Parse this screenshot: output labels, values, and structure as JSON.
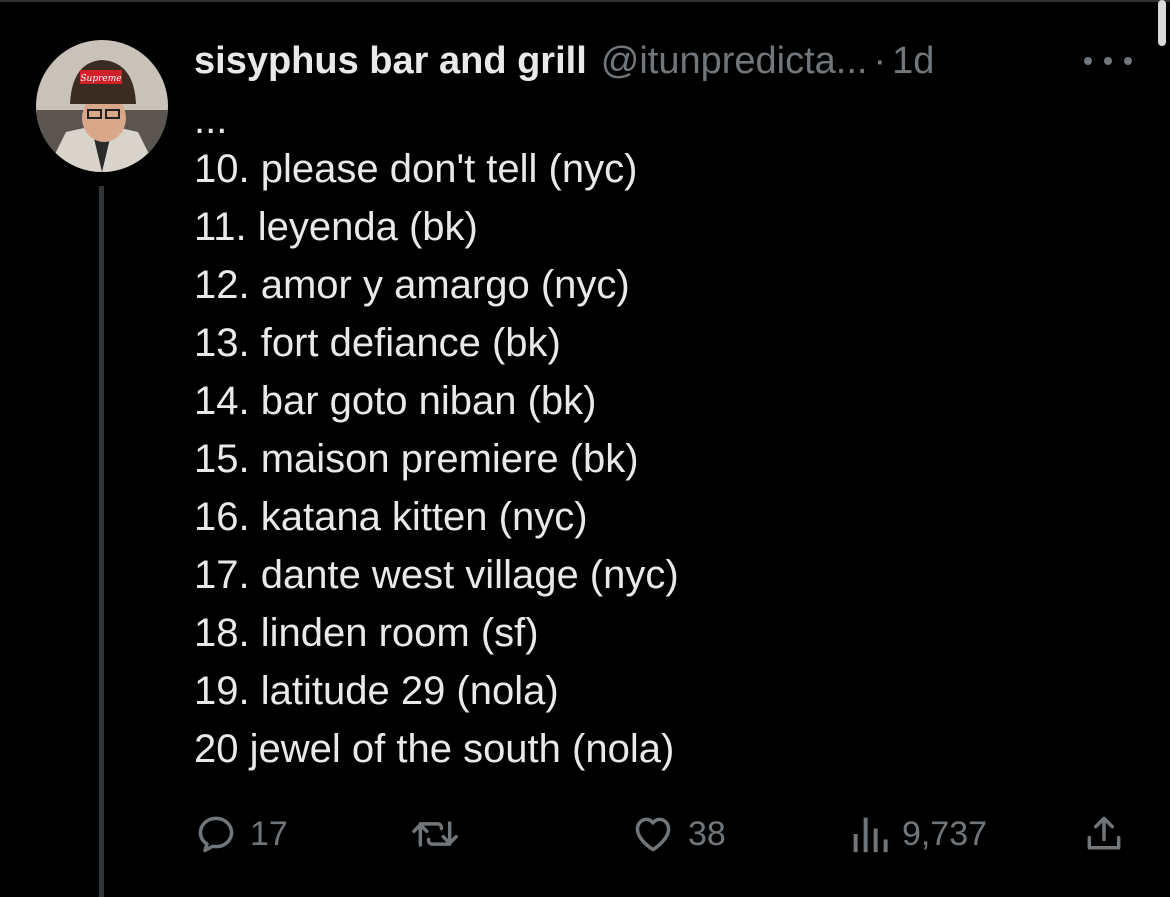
{
  "tweet": {
    "display_name": "sisyphus bar and grill",
    "handle": "@itunpredicta...",
    "separator": "·",
    "time": "1d",
    "lines": [
      "...",
      "10. please don't tell (nyc)",
      "11. leyenda (bk)",
      "12. amor y amargo (nyc)",
      "13. fort defiance (bk)",
      "14. bar goto niban (bk)",
      "15. maison premiere (bk)",
      "16. katana kitten (nyc)",
      "17. dante west village (nyc)",
      "18. linden room (sf)",
      "19. latitude 29 (nola)",
      "20 jewel of the south (nola)"
    ]
  },
  "actions": {
    "reply_count": "17",
    "retweet_count": "",
    "like_count": "38",
    "view_count": "9,737"
  },
  "icons": {
    "avatar": "avatar-photo",
    "avatar_hat_text": "Supreme",
    "more": "more-icon",
    "reply": "reply-icon",
    "retweet": "retweet-icon",
    "like": "like-icon",
    "views": "views-icon",
    "share": "share-icon"
  },
  "colors": {
    "background": "#000000",
    "text_primary": "#e7e9ea",
    "text_secondary": "#71767b",
    "thread_line": "#333639"
  }
}
